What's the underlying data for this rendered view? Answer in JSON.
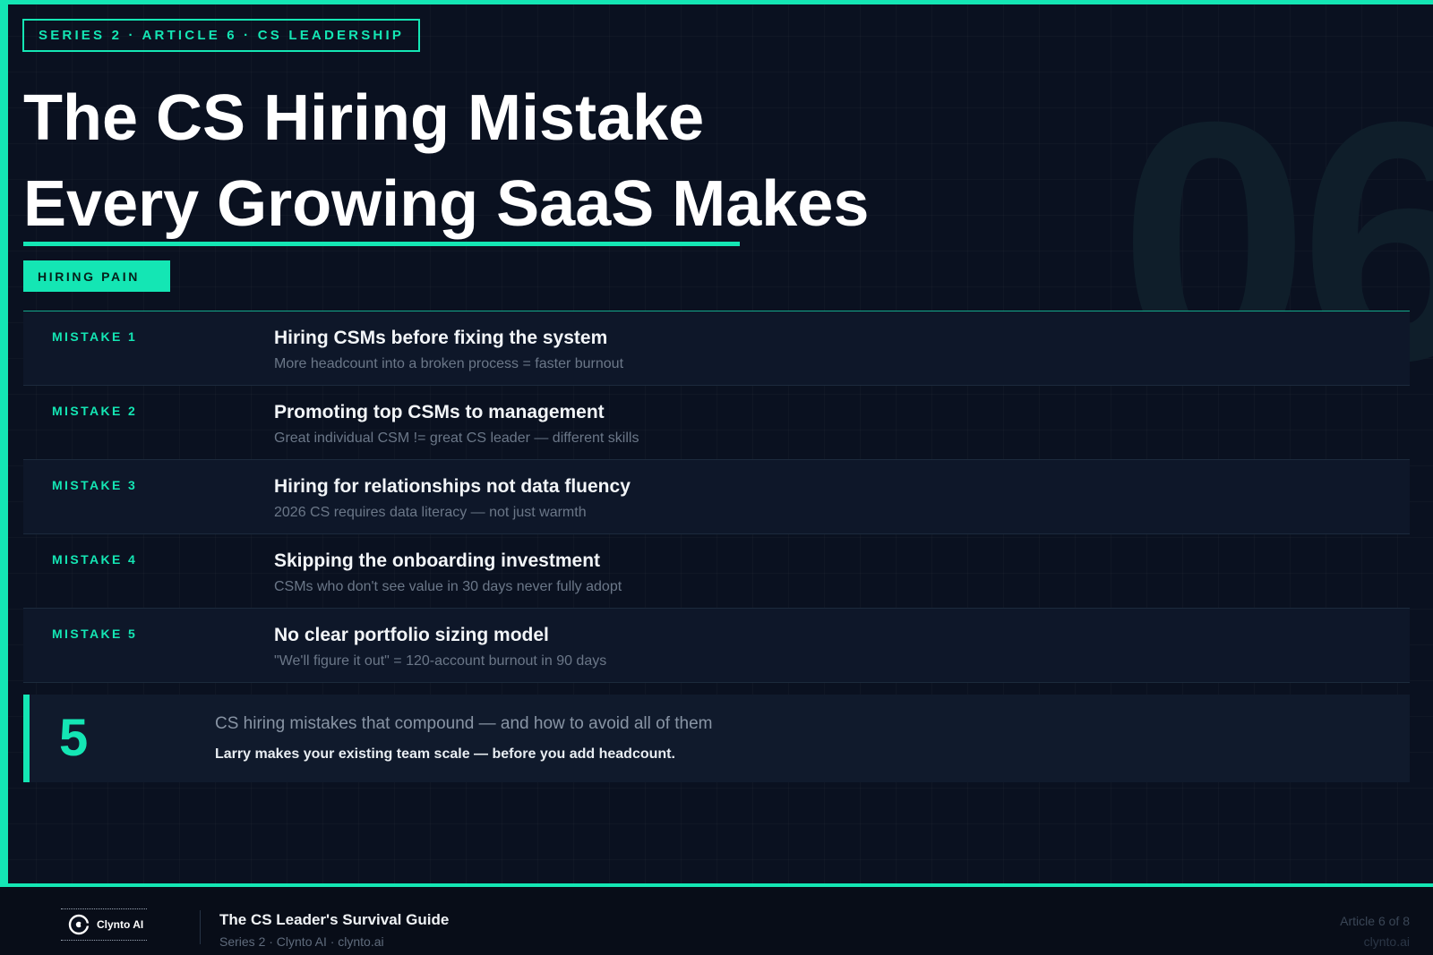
{
  "header": {
    "series_tag": "SERIES 2 · ARTICLE 6 · CS LEADERSHIP",
    "title_line1": "The CS Hiring Mistake",
    "title_line2": "Every Growing SaaS Makes",
    "watermark": "06",
    "badge": "HIRING PAIN"
  },
  "mistakes": [
    {
      "label": "MISTAKE 1",
      "title": "Hiring CSMs before fixing the system",
      "desc": "More headcount into a broken process = faster burnout"
    },
    {
      "label": "MISTAKE 2",
      "title": "Promoting top CSMs to management",
      "desc": "Great individual CSM != great CS leader — different skills"
    },
    {
      "label": "MISTAKE 3",
      "title": "Hiring for relationships not data fluency",
      "desc": "2026 CS requires data literacy — not just warmth"
    },
    {
      "label": "MISTAKE 4",
      "title": "Skipping the onboarding investment",
      "desc": "CSMs who don't see value in 30 days never fully adopt"
    },
    {
      "label": "MISTAKE 5",
      "title": "No clear portfolio sizing model",
      "desc": "\"We'll figure it out\" = 120-account burnout in 90 days"
    }
  ],
  "summary": {
    "number": "5",
    "line1": "CS hiring mistakes that compound — and how to avoid all of them",
    "line2": "Larry makes your existing team scale — before you add headcount."
  },
  "footer": {
    "logo_text": "Clynto AI",
    "title": "The CS Leader's Survival Guide",
    "subtitle": "Series 2 · Clynto AI · clynto.ai",
    "article_count": "Article 6 of 8",
    "domain": "clynto.ai"
  },
  "colors": {
    "accent": "#14e6b4",
    "background": "#0a1120"
  }
}
